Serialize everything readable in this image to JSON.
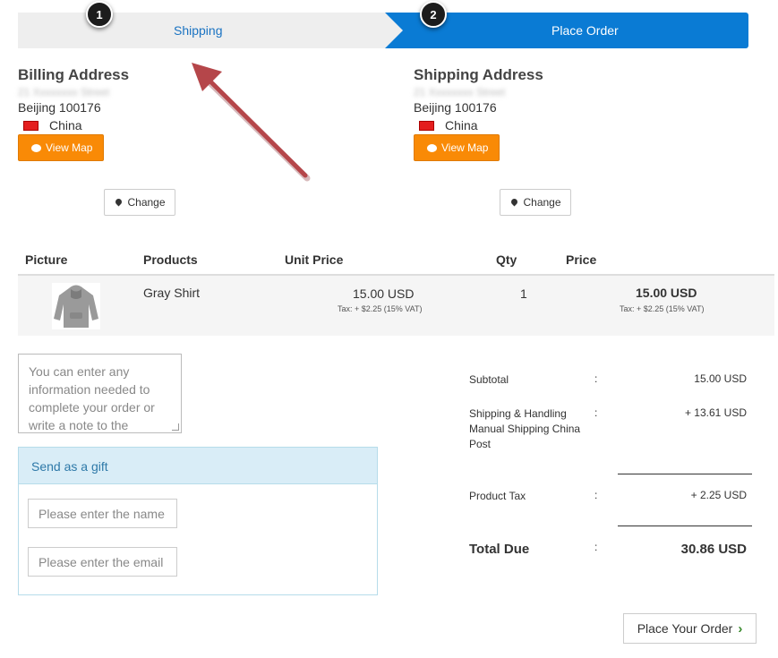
{
  "steps": [
    {
      "number": "1",
      "label": "Shipping"
    },
    {
      "number": "2",
      "label": "Place Order"
    }
  ],
  "billing": {
    "title": "Billing Address",
    "street_blurred": "21 Xxxxxxxx Street",
    "city": "Beijing 100176",
    "country": "China",
    "view_map": "View Map",
    "change": "Change"
  },
  "shipping": {
    "title": "Shipping Address",
    "street_blurred": "21 Xxxxxxxx Street",
    "city": "Beijing 100176",
    "country": "China",
    "view_map": "View Map",
    "change": "Change"
  },
  "table": {
    "headers": [
      "Picture",
      "Products",
      "Unit Price",
      "Qty",
      "Price"
    ],
    "rows": [
      {
        "product": "Gray Shirt",
        "unit_price": "15.00 USD",
        "unit_tax": "Tax: + $2.25 (15% VAT)",
        "qty": "1",
        "price": "15.00 USD",
        "price_tax": "Tax: + $2.25 (15% VAT)"
      }
    ]
  },
  "note": {
    "placeholder": "You can enter any information needed to complete your order or write a note to the"
  },
  "gift": {
    "title": "Send as a gift",
    "name_placeholder": "Please enter the name",
    "email_placeholder": "Please enter the email"
  },
  "totals": {
    "subtotal_label": "Subtotal",
    "subtotal_value": "15.00 USD",
    "shipping_label": "Shipping & Handling Manual Shipping China Post",
    "shipping_value": "+ 13.61 USD",
    "tax_label": "Product Tax",
    "tax_value": "+ 2.25 USD",
    "total_label": "Total Due",
    "total_value": "30.86 USD",
    "colon": ":"
  },
  "place_order_button": "Place Your Order",
  "colors": {
    "step_active": "#0a7bd4",
    "step_inactive": "#eeeeee",
    "map_button": "#f98a06",
    "gift_header": "#d9edf7",
    "annotation_arrow": "#b5464a"
  }
}
